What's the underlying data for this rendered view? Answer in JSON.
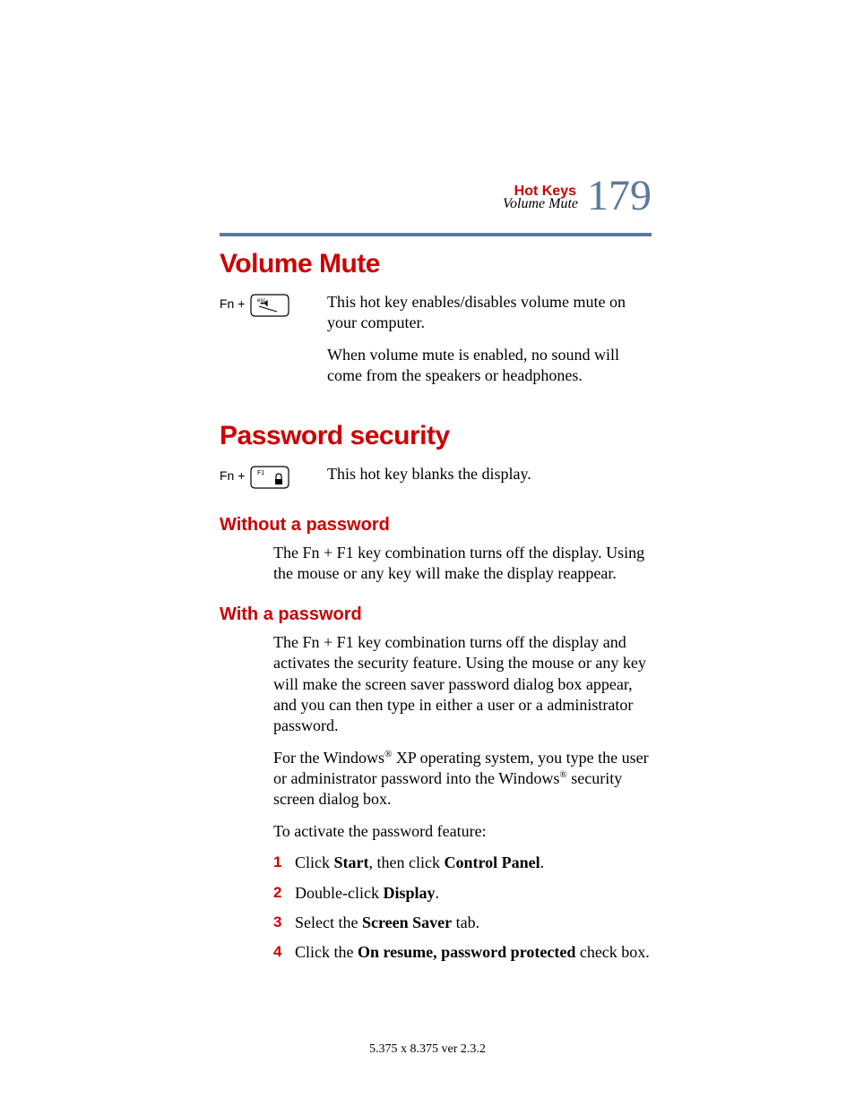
{
  "header": {
    "chapter": "Hot Keys",
    "section": "Volume Mute",
    "page_number": "179"
  },
  "sections": {
    "volume_mute": {
      "title": "Volume Mute",
      "fn_prefix": "Fn +",
      "key_top_label": "esc",
      "key_bottom_glyph": "🔇",
      "p1": "This hot key enables/disables volume mute on your computer.",
      "p2": "When volume mute is enabled, no sound will come from the speakers or headphones."
    },
    "password": {
      "title": "Password security",
      "fn_prefix": "Fn +",
      "key_top_label": "F1",
      "key_glyph": "🔒",
      "p1": "This hot key blanks the display.",
      "without": {
        "title": "Without a password",
        "p1": "The Fn + F1 key combination turns off the display. Using the mouse or any key will make the display reappear."
      },
      "with": {
        "title": "With a password",
        "p1": "The Fn + F1 key combination turns off the display and activates the security feature. Using the mouse or any key will make the screen saver password dialog box appear, and you can then type in either a user or a administrator password.",
        "p2_pre": "For the Windows",
        "p2_mid": " XP operating system, you type the user or administrator password into the Windows",
        "p2_post": " security screen dialog box.",
        "reg": "®",
        "p3": "To activate the password feature:",
        "steps": {
          "s1_pre": "Click ",
          "s1_b1": "Start",
          "s1_mid": ", then click ",
          "s1_b2": "Control Panel",
          "s1_post": ".",
          "s2_pre": "Double-click ",
          "s2_b1": "Display",
          "s2_post": ".",
          "s3_pre": "Select the ",
          "s3_b1": "Screen Saver",
          "s3_post": " tab.",
          "s4_pre": "Click the ",
          "s4_b1": "On resume, password protected",
          "s4_post": " check box."
        }
      }
    }
  },
  "footer": "5.375 x 8.375 ver 2.3.2"
}
